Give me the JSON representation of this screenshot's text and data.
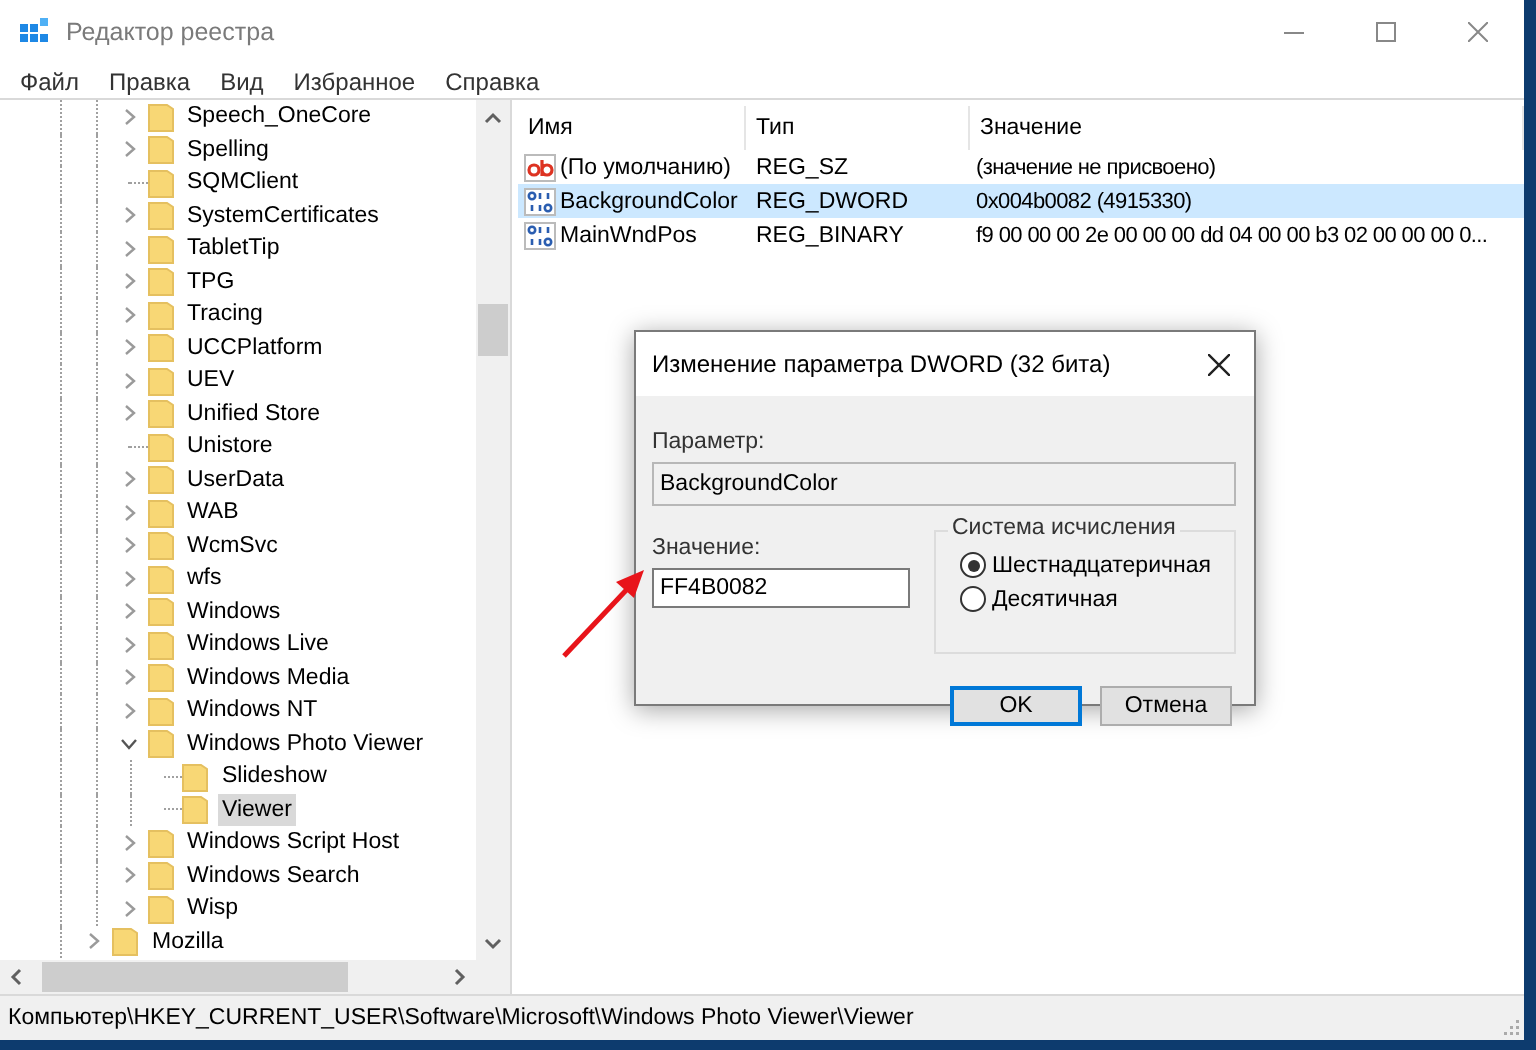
{
  "window": {
    "title": "Редактор реестра"
  },
  "menu": [
    "Файл",
    "Правка",
    "Вид",
    "Избранное",
    "Справка"
  ],
  "tree": {
    "items": [
      {
        "children": [
          {
            "label": "Speech_OneCore",
            "expanded": false,
            "selected": false
          },
          {
            "label": "Spelling",
            "expanded": false,
            "selected": false
          },
          {
            "label": "SQMClient",
            "selected": false
          },
          {
            "label": "SystemCertificates",
            "expanded": false,
            "selected": false
          },
          {
            "label": "TabletTip",
            "expanded": false,
            "selected": false
          },
          {
            "label": "TPG",
            "expanded": false,
            "selected": false
          },
          {
            "label": "Tracing",
            "expanded": false,
            "selected": false
          },
          {
            "label": "UCCPlatform",
            "expanded": false,
            "selected": false
          },
          {
            "label": "UEV",
            "expanded": false,
            "selected": false
          },
          {
            "label": "Unified Store",
            "expanded": false,
            "selected": false
          },
          {
            "label": "Unistore",
            "selected": false
          },
          {
            "label": "UserData",
            "expanded": false,
            "selected": false
          },
          {
            "label": "WAB",
            "expanded": false,
            "selected": false
          },
          {
            "label": "WcmSvc",
            "expanded": false,
            "selected": false
          },
          {
            "label": "wfs",
            "expanded": false,
            "selected": false
          },
          {
            "label": "Windows",
            "expanded": false,
            "selected": false
          },
          {
            "label": "Windows Live",
            "expanded": false,
            "selected": false
          },
          {
            "label": "Windows Media",
            "expanded": false,
            "selected": false
          },
          {
            "label": "Windows NT",
            "expanded": false,
            "selected": false
          },
          {
            "label": "Windows Photo Viewer",
            "expanded": true,
            "selected": false,
            "children": [
              {
                "label": "Slideshow",
                "selected": false
              },
              {
                "label": "Viewer",
                "selected": true
              }
            ]
          },
          {
            "label": "Windows Script Host",
            "expanded": false,
            "selected": false
          },
          {
            "label": "Windows Search",
            "expanded": false,
            "selected": false
          },
          {
            "label": "Wisp",
            "expanded": false,
            "selected": false
          }
        ]
      },
      {
        "label": "Mozilla",
        "expanded": false,
        "selected": false
      }
    ]
  },
  "values": {
    "columns": [
      "Имя",
      "Тип",
      "Значение"
    ],
    "rows": [
      {
        "kind": "string",
        "name": "(По умолчанию)",
        "type": "REG_SZ",
        "data": "(значение не присвоено)",
        "selected": false
      },
      {
        "kind": "binary",
        "name": "BackgroundColor",
        "type": "REG_DWORD",
        "data": "0x004b0082 (4915330)",
        "selected": true
      },
      {
        "kind": "binary",
        "name": "MainWndPos",
        "type": "REG_BINARY",
        "data": "f9 00 00 00 2e 00 00 00 dd 04 00 00 b3 02 00 00 00 0...",
        "selected": false
      }
    ]
  },
  "dialog": {
    "title": "Изменение параметра DWORD (32 бита)",
    "name_label": "Параметр:",
    "name_value": "BackgroundColor",
    "value_label": "Значение:",
    "value": "FF4B0082",
    "base_group": "Система исчисления",
    "bases": [
      {
        "label": "Шестнадцатеричная",
        "selected": true
      },
      {
        "label": "Десятичная",
        "selected": false
      }
    ],
    "buttons": [
      {
        "label": "OK",
        "default": true
      },
      {
        "label": "Отмена",
        "default": false
      }
    ]
  },
  "status_bar": "Компьютер\\HKEY_CURRENT_USER\\Software\\Microsoft\\Windows Photo Viewer\\Viewer"
}
